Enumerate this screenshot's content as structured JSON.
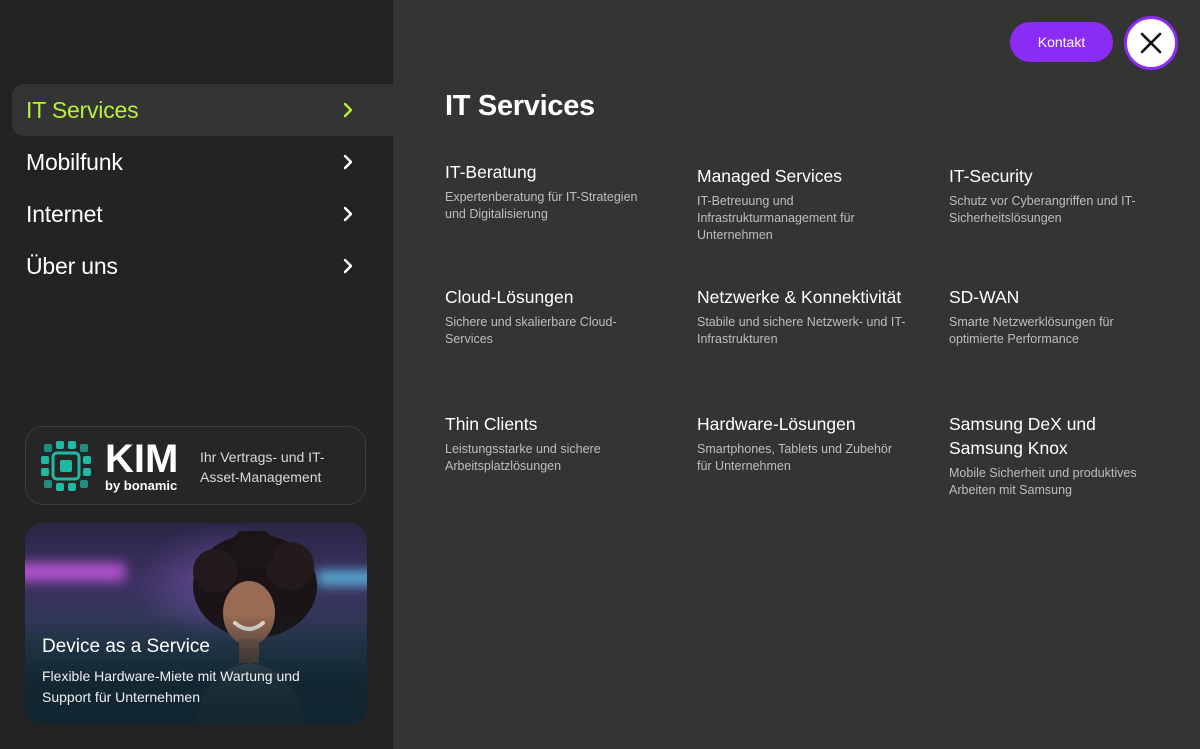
{
  "nav": {
    "items": [
      {
        "label": "IT Services",
        "active": true
      },
      {
        "label": "Mobilfunk",
        "active": false
      },
      {
        "label": "Internet",
        "active": false
      },
      {
        "label": "Über uns",
        "active": false
      }
    ]
  },
  "kim": {
    "wordmark": "KIM",
    "byline": "by bonamic",
    "tagline": "Ihr Vertrags- und IT-Asset-Management"
  },
  "daas": {
    "title": "Device as a Service",
    "description": "Flexible Hardware-Miete mit Wartung und Support für Unternehmen"
  },
  "header": {
    "contact_label": "Kontakt"
  },
  "main": {
    "title": "IT Services",
    "services": [
      {
        "title": "IT-Beratung",
        "desc": "Expertenberatung für IT-Strategien und Digitalisierung"
      },
      {
        "title": "Managed Services",
        "desc": "IT-Betreuung und Infrastrukturmanagement für Unternehmen"
      },
      {
        "title": "IT-Security",
        "desc": "Schutz vor Cyberangriffen und IT-Sicherheitslösungen"
      },
      {
        "title": "Cloud-Lösungen",
        "desc": "Sichere und skalierbare Cloud-Services"
      },
      {
        "title": "Netzwerke & Konnektivität",
        "desc": "Stabile und sichere Netzwerk- und IT-Infrastrukturen"
      },
      {
        "title": "SD-WAN",
        "desc": "Smarte Netzwerklösungen für optimierte Performance"
      },
      {
        "title": "Thin Clients",
        "desc": "Leistungsstarke und sichere Arbeitsplatzlösungen"
      },
      {
        "title": "Hardware-Lösungen",
        "desc": "Smartphones, Tablets und Zubehör für Unternehmen"
      },
      {
        "title": "Samsung DeX und Samsung Knox",
        "desc": "Mobile Sicherheit und produktives Arbeiten mit Samsung"
      }
    ]
  },
  "colors": {
    "accent_green": "#b7f13a",
    "accent_purple": "#8b2cf5",
    "kim_teal": "#1fb9a4"
  },
  "icons": {
    "chevron": "chevron-right-icon",
    "close": "close-icon",
    "kim_logo": "kim-chip-logo-icon"
  }
}
